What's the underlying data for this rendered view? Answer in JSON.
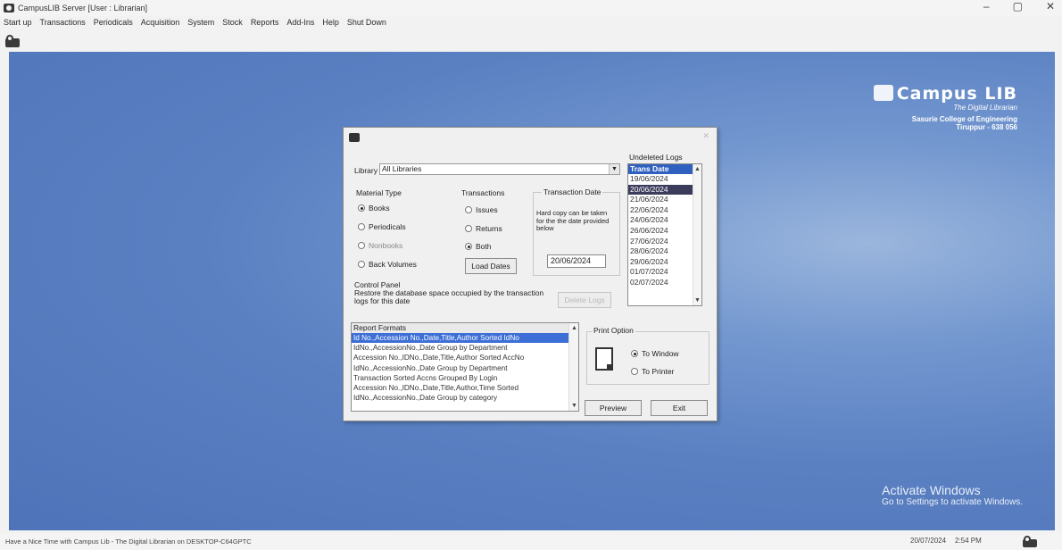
{
  "window": {
    "title": "CampusLIB Server [User : Librarian]",
    "controls": [
      "–",
      "▢",
      "✕"
    ]
  },
  "menu": [
    "Start up",
    "Transactions",
    "Periodicals",
    "Acquisition",
    "System",
    "Stock",
    "Reports",
    "Add-Ins",
    "Help",
    "Shut Down"
  ],
  "brand": {
    "logo": "Campus LIB",
    "tagline": "The Digital Librarian",
    "college": "Sasurie College of Engineering",
    "city": "Tiruppur - 638 056"
  },
  "watermark": {
    "line1": "Activate Windows",
    "line2": "Go to Settings to activate Windows."
  },
  "dialog": {
    "library_label": "Library",
    "library_value": "All Libraries",
    "material_type_label": "Material Type",
    "material_types": [
      {
        "label": "Books",
        "selected": true
      },
      {
        "label": "Periodicals",
        "selected": false
      },
      {
        "label": "Nonbooks",
        "selected": false
      },
      {
        "label": "Back Volumes",
        "selected": false
      }
    ],
    "transactions_label": "Transactions",
    "transactions": [
      {
        "label": "Issues",
        "selected": false
      },
      {
        "label": "Returns",
        "selected": false
      },
      {
        "label": "Both",
        "selected": true
      }
    ],
    "load_dates_button": "Load Dates",
    "transaction_date_label": "Transaction Date",
    "transaction_date_note": "Hard copy can be taken for the the date provided below",
    "transaction_date_value": "20/06/2024",
    "control_panel_label": "Control Panel",
    "control_panel_text": "Restore the database space occupied by the transaction logs for this date",
    "delete_button": "Delete Logs",
    "undeleted_logs_label": "Undeleted Logs",
    "logs_header": "Trans Date",
    "logs": [
      "19/06/2024",
      "20/06/2024",
      "21/06/2024",
      "22/06/2024",
      "24/06/2024",
      "26/06/2024",
      "27/06/2024",
      "28/06/2024",
      "29/06/2024",
      "01/07/2024",
      "02/07/2024"
    ],
    "logs_selected_index": 1,
    "report_formats_label": "Report Formats",
    "report_formats": [
      "Id No.,Accession No.,Date,Title,Author Sorted IdNo",
      "IdNo.,AccessionNo.,Date Group by Department",
      "Accession No.,IDNo.,Date,Title,Author Sorted AccNo",
      "IdNo.,AccessionNo.,Date Group by Department",
      "Transaction Sorted Accns Grouped By Login",
      "Accession No.,IDNo.,Date,Title,Author,Time Sorted",
      "IdNo.,AccessionNo.,Date Group by category"
    ],
    "report_selected_index": 0,
    "print_option_label": "Print Option",
    "print_options": [
      {
        "label": "To Window",
        "selected": true
      },
      {
        "label": "To Printer",
        "selected": false
      }
    ],
    "preview_button": "Preview",
    "exit_button": "Exit"
  },
  "statusbar": {
    "message": "Have a Nice Time with Campus Lib - The Digital Librarian on DESKTOP-C64GPTC",
    "date": "20/07/2024",
    "time": "2:54 PM"
  }
}
